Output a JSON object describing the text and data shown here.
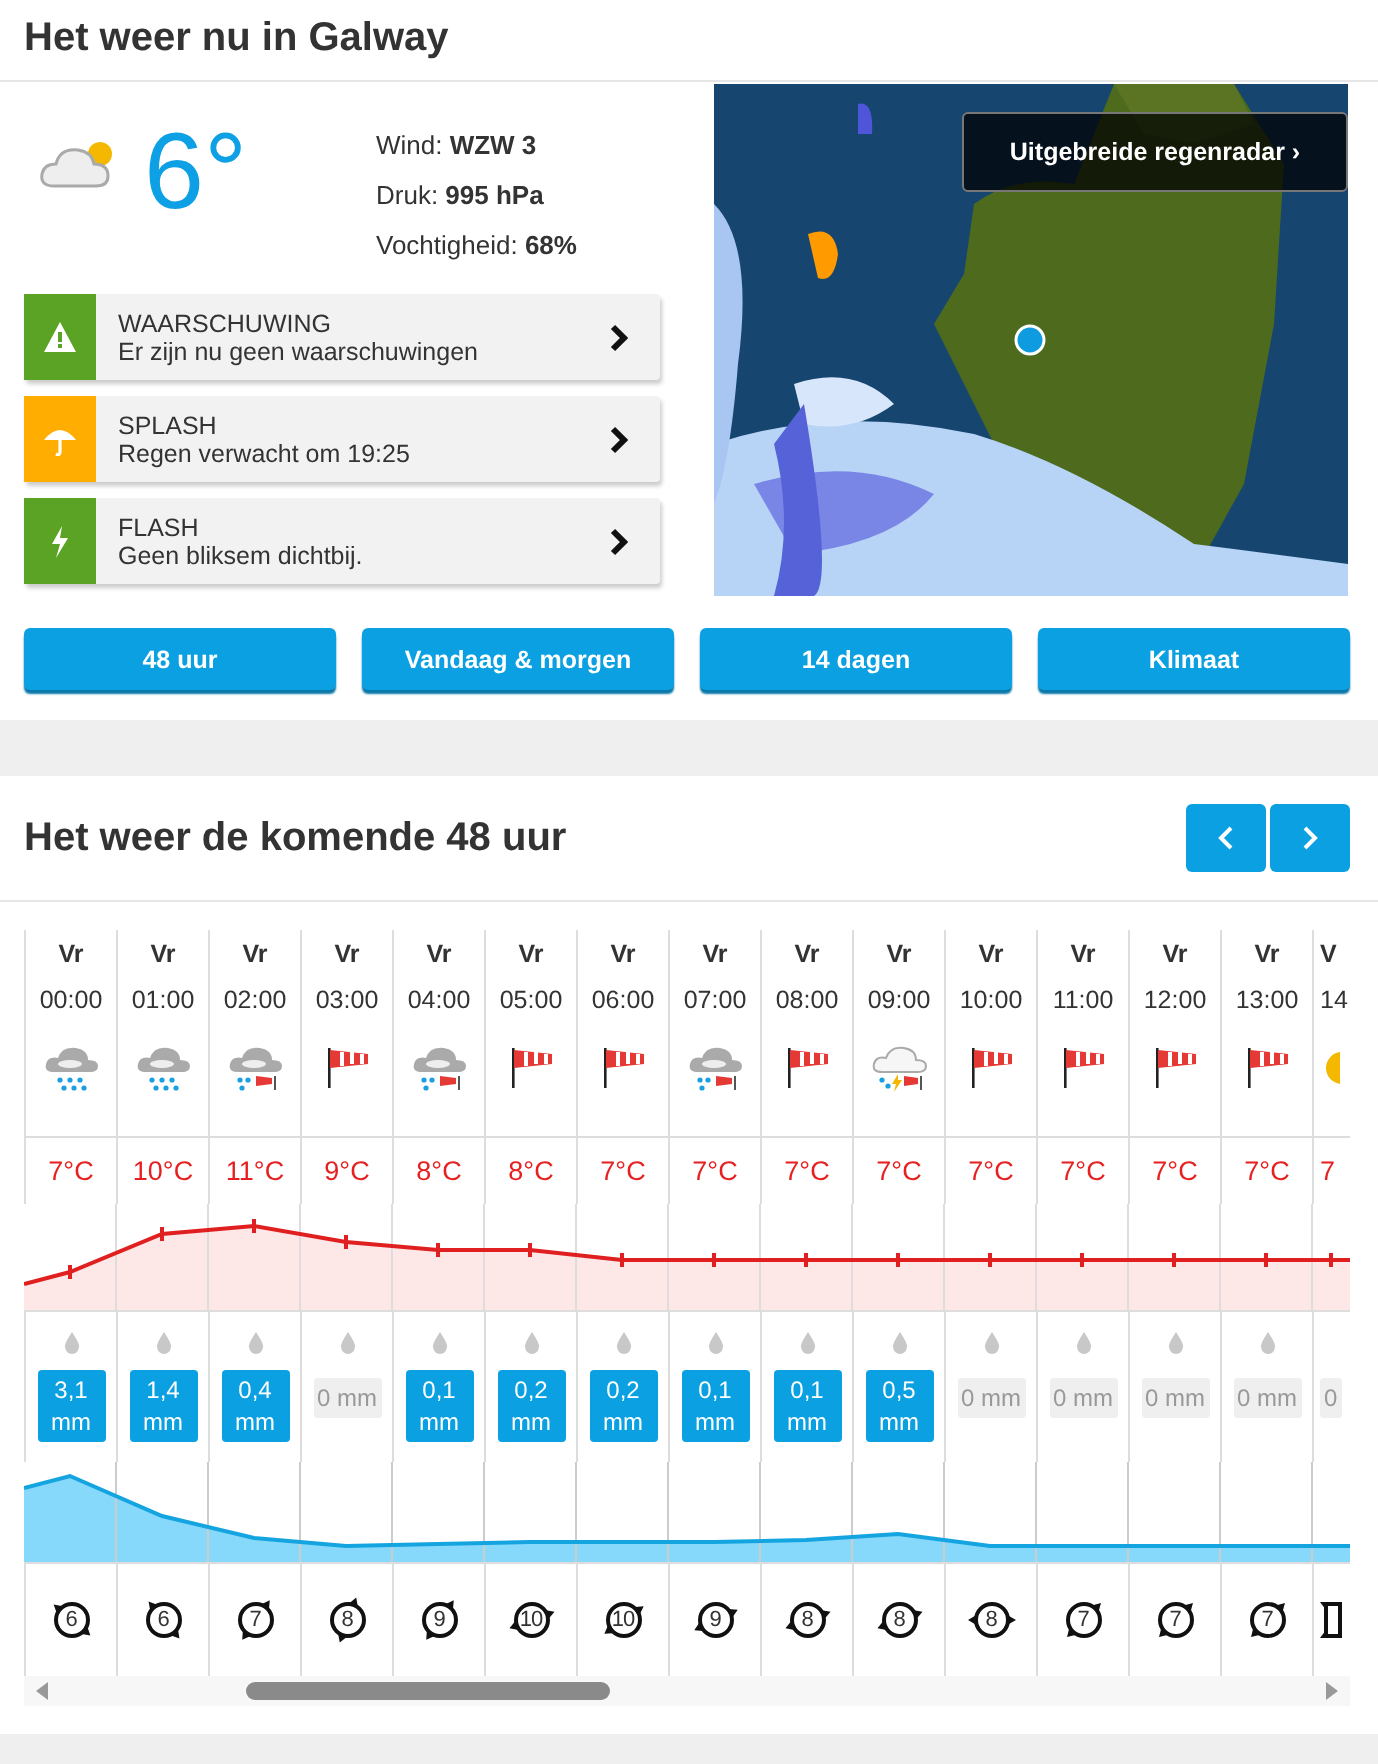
{
  "current": {
    "title": "Het weer nu in Galway",
    "temperature": "6°",
    "details": [
      {
        "label": "Wind:",
        "value": "WZW 3"
      },
      {
        "label": "Druk:",
        "value": "995 hPa"
      },
      {
        "label": "Vochtigheid:",
        "value": "68%"
      }
    ]
  },
  "alerts": [
    {
      "kind": "warning",
      "color": "#5aa324",
      "title": "WAARSCHUWING",
      "text": "Er zijn nu geen waarschuwingen"
    },
    {
      "kind": "splash",
      "color": "#ffad00",
      "title": "SPLASH",
      "text": "Regen verwacht om 19:25"
    },
    {
      "kind": "flash",
      "color": "#5aa324",
      "title": "FLASH",
      "text": "Geen bliksem dichtbij."
    }
  ],
  "radar": {
    "kind": "picture",
    "link": "Uitgebreide regenradar ›"
  },
  "buttons": [
    "48 uur",
    "Vandaag & morgen",
    "14 dagen",
    "Klimaat"
  ],
  "forecast": {
    "title": "Het weer de komende 48 uur",
    "hours": [
      {
        "day": "Vr",
        "time": "00:00",
        "kind": "rain",
        "temp": "7°C",
        "rain": "3,1 mm",
        "wet": true,
        "wind": "6"
      },
      {
        "day": "Vr",
        "time": "01:00",
        "kind": "rain",
        "temp": "10°C",
        "rain": "1,4 mm",
        "wet": true,
        "wind": "6"
      },
      {
        "day": "Vr",
        "time": "02:00",
        "kind": "rain-wind",
        "temp": "11°C",
        "rain": "0,4 mm",
        "wet": true,
        "wind": "7"
      },
      {
        "day": "Vr",
        "time": "03:00",
        "kind": "windsock",
        "temp": "9°C",
        "rain": "0 mm",
        "wet": false,
        "wind": "8"
      },
      {
        "day": "Vr",
        "time": "04:00",
        "kind": "rain-wind",
        "temp": "8°C",
        "rain": "0,1 mm",
        "wet": true,
        "wind": "9"
      },
      {
        "day": "Vr",
        "time": "05:00",
        "kind": "windsock",
        "temp": "8°C",
        "rain": "0,2 mm",
        "wet": true,
        "wind": "10"
      },
      {
        "day": "Vr",
        "time": "06:00",
        "kind": "windsock",
        "temp": "7°C",
        "rain": "0,2 mm",
        "wet": true,
        "wind": "10"
      },
      {
        "day": "Vr",
        "time": "07:00",
        "kind": "rain-wind",
        "temp": "7°C",
        "rain": "0,1 mm",
        "wet": true,
        "wind": "9"
      },
      {
        "day": "Vr",
        "time": "08:00",
        "kind": "windsock",
        "temp": "7°C",
        "rain": "0,1 mm",
        "wet": true,
        "wind": "8"
      },
      {
        "day": "Vr",
        "time": "09:00",
        "kind": "thunder-wind",
        "temp": "7°C",
        "rain": "0,5 mm",
        "wet": true,
        "wind": "8"
      },
      {
        "day": "Vr",
        "time": "10:00",
        "kind": "windsock",
        "temp": "7°C",
        "rain": "0 mm",
        "wet": false,
        "wind": "8"
      },
      {
        "day": "Vr",
        "time": "11:00",
        "kind": "windsock",
        "temp": "7°C",
        "rain": "0 mm",
        "wet": false,
        "wind": "7"
      },
      {
        "day": "Vr",
        "time": "12:00",
        "kind": "windsock",
        "temp": "7°C",
        "rain": "0 mm",
        "wet": false,
        "wind": "7"
      },
      {
        "day": "Vr",
        "time": "13:00",
        "kind": "windsock",
        "temp": "7°C",
        "rain": "0 mm",
        "wet": false,
        "wind": "7"
      },
      {
        "day": "V",
        "time": "14",
        "kind": "sun",
        "temp": "7",
        "rain": "0",
        "wet": false
      }
    ]
  }
}
